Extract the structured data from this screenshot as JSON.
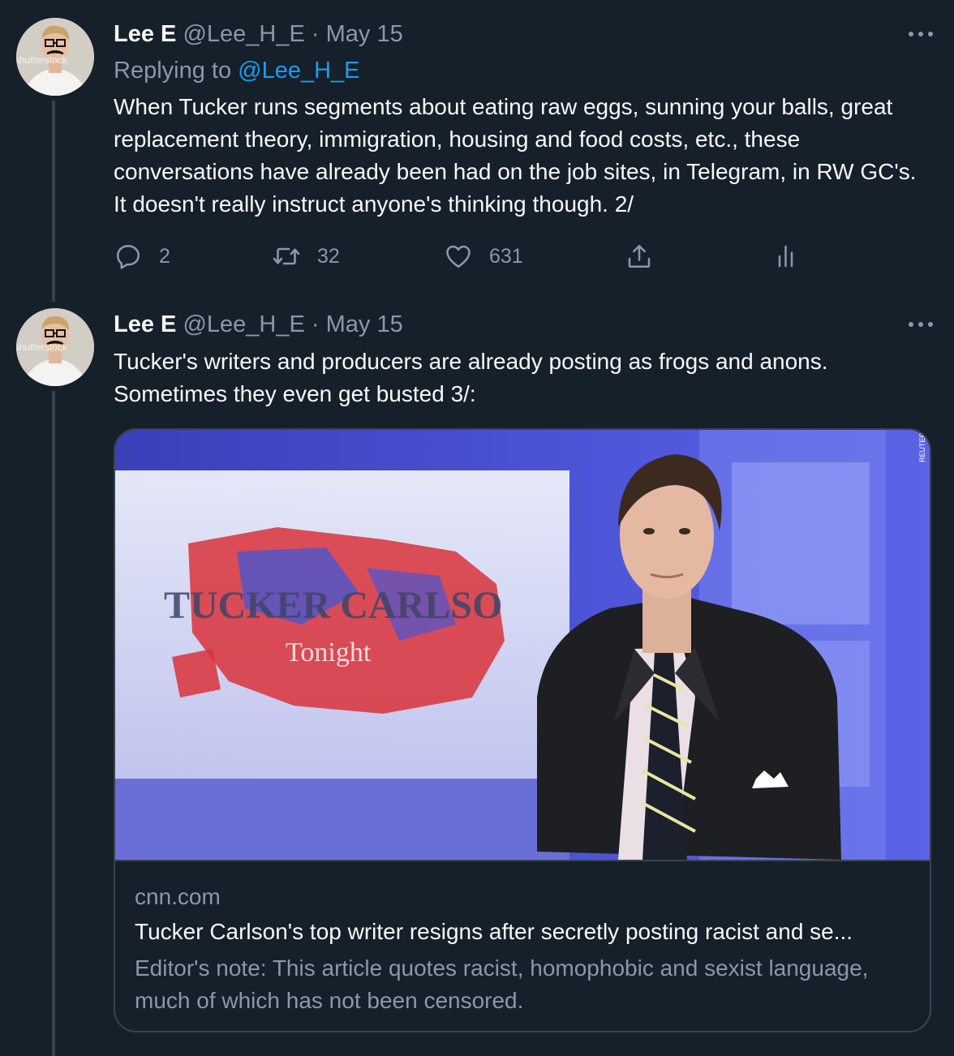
{
  "tweets": [
    {
      "name": "Lee E",
      "handle": "@Lee_H_E",
      "separator": "·",
      "date": "May 15",
      "replying_prefix": "Replying to ",
      "replying_to": "@Lee_H_E",
      "text": "When Tucker runs segments about eating raw eggs, sunning your balls, great replacement theory, immigration, housing and food costs, etc., these conversations have already been had on the job sites, in Telegram, in RW GC's. It doesn't really instruct anyone's thinking though. 2/",
      "avatar_watermark": "shutterstock",
      "actions": {
        "reply_count": "2",
        "retweet_count": "32",
        "like_count": "631"
      }
    },
    {
      "name": "Lee E",
      "handle": "@Lee_H_E",
      "separator": "·",
      "date": "May 15",
      "text": "Tucker's writers and producers are already posting as frogs and anons. Sometimes they even get busted 3/:",
      "avatar_watermark": "shutterstock",
      "card": {
        "image_text_main": "TUCKER CARLSO",
        "image_text_sub": "Tonight",
        "image_credit": "REUTERS",
        "domain": "cnn.com",
        "title": "Tucker Carlson's top writer resigns after secretly posting racist and se...",
        "description": "Editor's note: This article quotes racist, homophobic and sexist language, much of which has not been censored."
      }
    }
  ],
  "icons": {
    "reply": "reply-icon",
    "retweet": "retweet-icon",
    "like": "heart-icon",
    "share": "share-icon",
    "analytics": "analytics-icon",
    "more": "more-icon"
  },
  "colors": {
    "background": "#15202b",
    "text": "#f7f9f9",
    "muted": "#8b98a5",
    "link": "#1d9bf0",
    "border": "#38444d"
  }
}
